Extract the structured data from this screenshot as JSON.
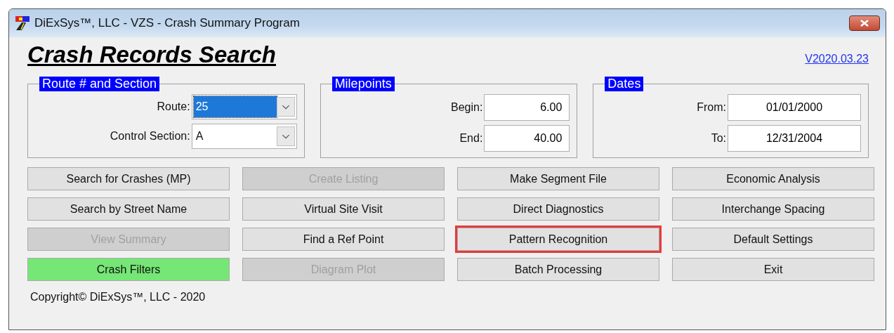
{
  "window": {
    "title": "DiExSys™, LLC - VZS - Crash Summary Program"
  },
  "heading": "Crash Records Search",
  "version_link": "V2020.03.23",
  "groups": [
    {
      "title": "Route # and Section",
      "fields": [
        {
          "kind": "dropdown",
          "label": "Route:",
          "value": "25",
          "selected": true
        },
        {
          "kind": "dropdown",
          "label": "Control Section:",
          "value": "A",
          "selected": false
        }
      ]
    },
    {
      "title": "Milepoints",
      "fields": [
        {
          "kind": "number",
          "label": "Begin:",
          "value": "6.00"
        },
        {
          "kind": "number",
          "label": "End:",
          "value": "40.00"
        }
      ]
    },
    {
      "title": "Dates",
      "fields": [
        {
          "kind": "date",
          "label": "From:",
          "value": "01/01/2000"
        },
        {
          "kind": "date",
          "label": "To:",
          "value": "12/31/2004"
        }
      ]
    }
  ],
  "buttons": [
    {
      "label": "Search for Crashes (MP)",
      "disabled": false,
      "active": false,
      "outlined": false
    },
    {
      "label": "Search by Street Name",
      "disabled": false,
      "active": false,
      "outlined": false
    },
    {
      "label": "View Summary",
      "disabled": true,
      "active": false,
      "outlined": false
    },
    {
      "label": "Crash Filters",
      "disabled": false,
      "active": true,
      "outlined": false
    },
    {
      "label": "Create Listing",
      "disabled": true,
      "active": false,
      "outlined": false
    },
    {
      "label": "Virtual Site Visit",
      "disabled": false,
      "active": false,
      "outlined": false
    },
    {
      "label": "Find a Ref Point",
      "disabled": false,
      "active": false,
      "outlined": false
    },
    {
      "label": "Diagram Plot",
      "disabled": true,
      "active": false,
      "outlined": false
    },
    {
      "label": "Make Segment File",
      "disabled": false,
      "active": false,
      "outlined": false
    },
    {
      "label": "Direct Diagnostics",
      "disabled": false,
      "active": false,
      "outlined": false
    },
    {
      "label": "Pattern Recognition",
      "disabled": false,
      "active": false,
      "outlined": true
    },
    {
      "label": "Batch Processing",
      "disabled": false,
      "active": false,
      "outlined": false
    },
    {
      "label": "Economic Analysis",
      "disabled": false,
      "active": false,
      "outlined": false
    },
    {
      "label": "Interchange Spacing",
      "disabled": false,
      "active": false,
      "outlined": false
    },
    {
      "label": "Default Settings",
      "disabled": false,
      "active": false,
      "outlined": false
    },
    {
      "label": "Exit",
      "disabled": false,
      "active": false,
      "outlined": false
    }
  ],
  "copyright": "Copyright© DiExSys™, LLC - 2020"
}
